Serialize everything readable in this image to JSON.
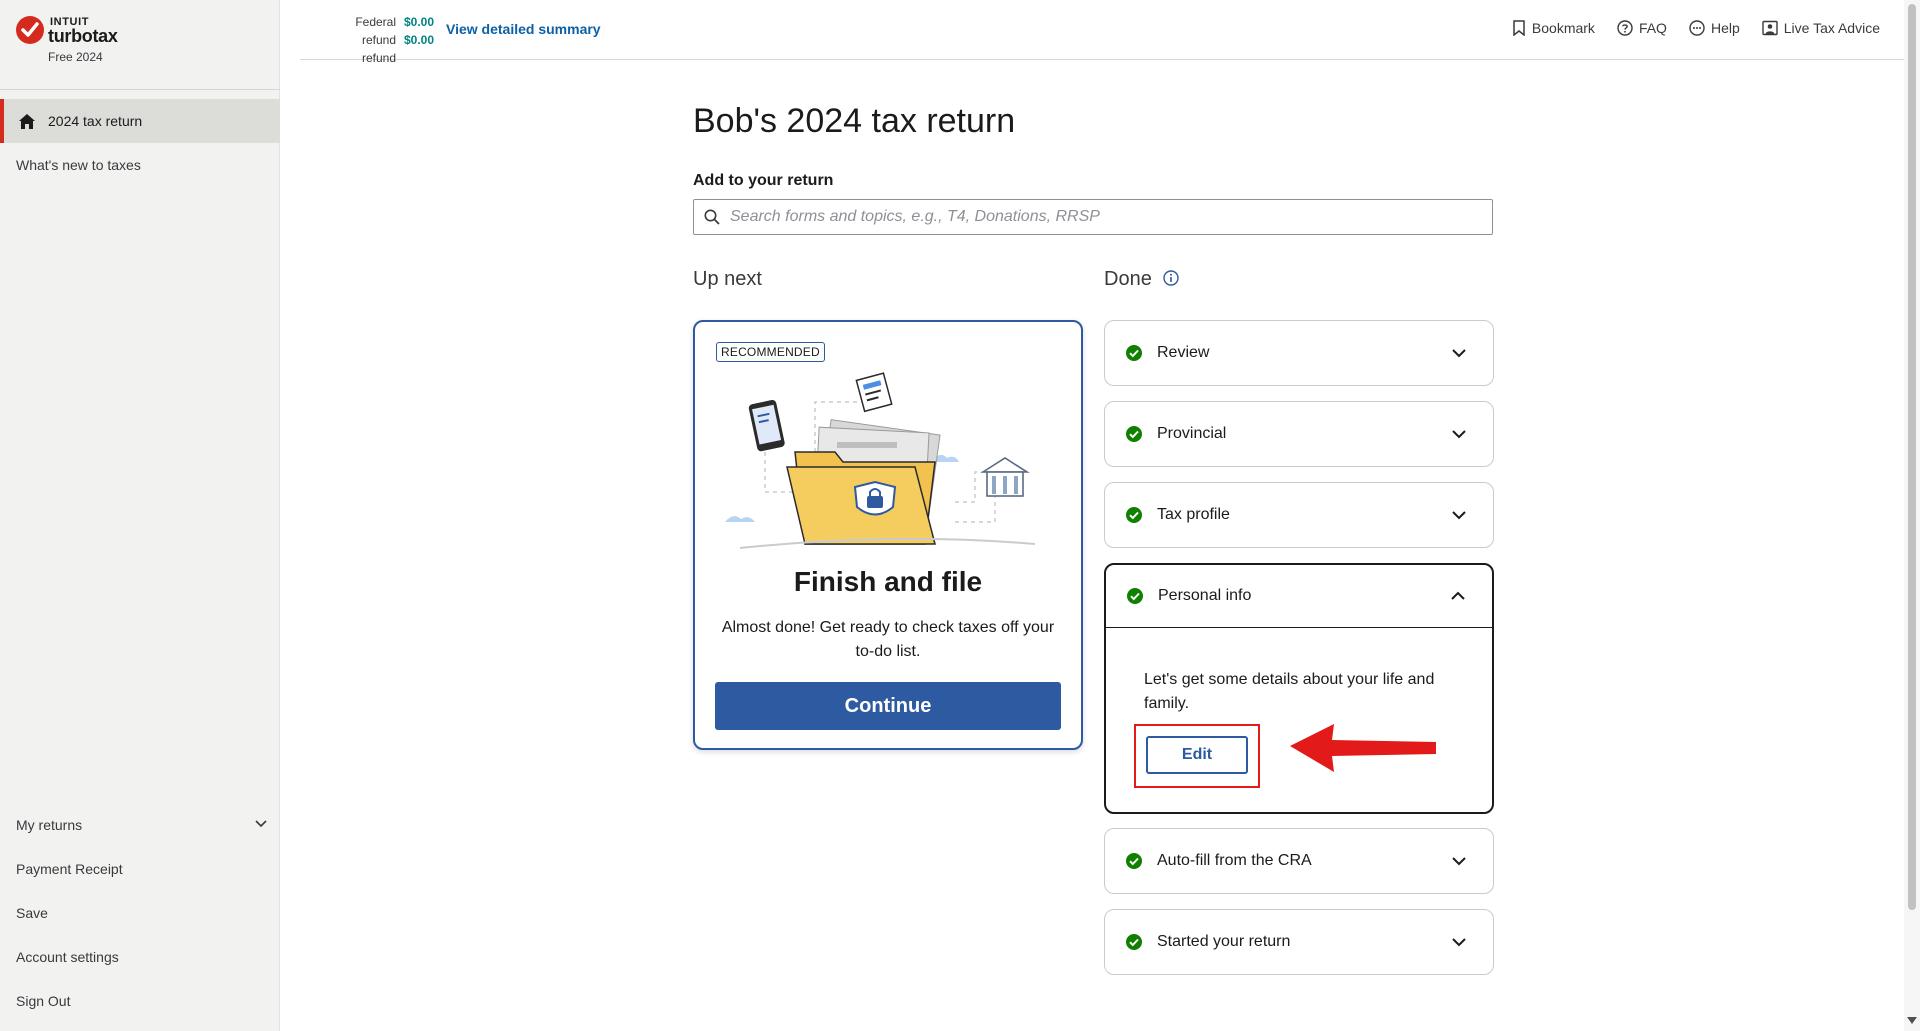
{
  "app": {
    "brand_intuit": "INTUIT",
    "brand_name": "turbotax",
    "edition": "Free 2024",
    "accent_color": "#d52b1e",
    "primary_color": "#2d5aa0"
  },
  "sidebar": {
    "active_item": {
      "label": "2024 tax return",
      "icon": "home-icon"
    },
    "items": [
      {
        "label": "What's new to taxes"
      }
    ],
    "bottom_items": [
      {
        "label": "My returns"
      },
      {
        "label": "Payment Receipt"
      },
      {
        "label": "Save"
      },
      {
        "label": "Account settings"
      },
      {
        "label": "Sign Out"
      }
    ]
  },
  "header": {
    "federal_label": "Federal refund",
    "provincial_label": "refund",
    "federal_value": "$0.00",
    "provincial_value": "$0.00",
    "summary_link": "View detailed summary",
    "actions": [
      {
        "label": "Bookmark",
        "icon": "bookmark-icon"
      },
      {
        "label": "FAQ",
        "icon": "question-icon"
      },
      {
        "label": "Help",
        "icon": "chat-icon"
      },
      {
        "label": "Live Tax Advice",
        "icon": "expert-icon"
      }
    ]
  },
  "main": {
    "title": "Bob's 2024 tax return",
    "add_label": "Add to your return",
    "search_placeholder": "Search forms and topics, e.g., T4, Donations, RRSP",
    "up_next_heading": "Up next",
    "done_heading": "Done",
    "recommended": {
      "badge": "RECOMMENDED",
      "title": "Finish and file",
      "description": "Almost done! Get ready to check taxes off your to-do list.",
      "button": "Continue"
    },
    "done_sections": [
      {
        "label": "Review",
        "status_icon": "check-circle-icon"
      },
      {
        "label": "Provincial",
        "status_icon": "check-circle-icon"
      },
      {
        "label": "Tax profile",
        "status_icon": "check-circle-icon"
      },
      {
        "label": "Personal info",
        "status_icon": "check-circle-icon",
        "expanded": true,
        "description": "Let's get some details about your life and family.",
        "button": "Edit"
      },
      {
        "label": "Auto-fill from the CRA",
        "status_icon": "check-circle-icon"
      },
      {
        "label": "Started your return",
        "status_icon": "check-circle-icon"
      }
    ],
    "status_color": "#108000",
    "annotation_color": "#e21a1a"
  }
}
